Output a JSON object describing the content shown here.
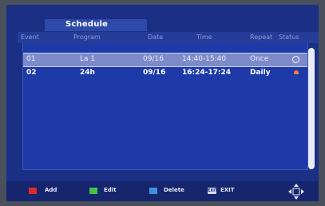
{
  "title": "Schedule",
  "columns": [
    "Event",
    "Program",
    "Date",
    "Time",
    "Repeat",
    "Status"
  ],
  "rows": [
    {
      "event": "01",
      "program": "La 1",
      "date": "09/16",
      "time": "14:40-15:40",
      "repeat": "Once",
      "status": "empty-circle-icon"
    },
    {
      "event": "02",
      "program": "24h",
      "date": "09/16",
      "time": "16:24-17:24",
      "repeat": "Daily",
      "status": "alarm-icon"
    }
  ],
  "footer": {
    "add_label": "Add",
    "edit_label": "Edit",
    "delete_label": "Delete",
    "exit_key_text": "EXIT",
    "exit_label": "EXIT"
  },
  "colors": {
    "add": "#e02b2b",
    "edit": "#44c24a",
    "delete": "#3f8fe0"
  }
}
